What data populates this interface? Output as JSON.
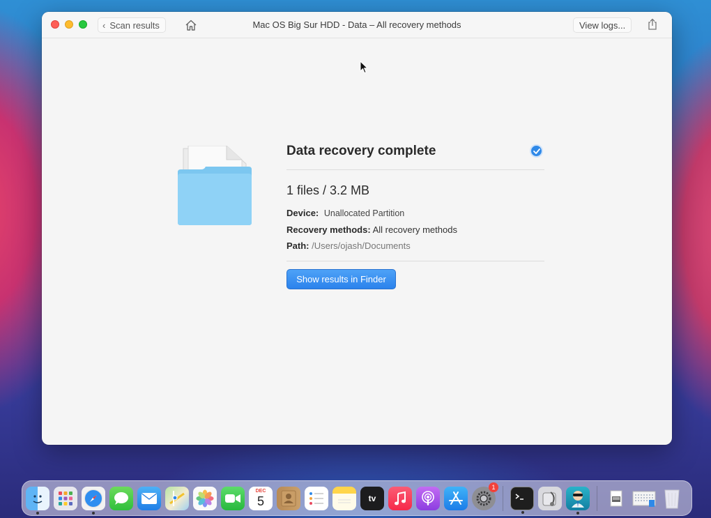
{
  "window": {
    "title": "Mac OS Big Sur HDD - Data – All recovery methods",
    "back_label": "Scan results",
    "logs_label": "View logs..."
  },
  "result": {
    "title": "Data recovery complete",
    "summary": "1 files / 3.2 MB",
    "device_key": "Device:",
    "device_value": "Unallocated Partition",
    "methods_key": "Recovery methods:",
    "methods_value": "All recovery methods",
    "path_key": "Path:",
    "path_value": "/Users/ojash/Documents",
    "button_label": "Show results in Finder"
  },
  "dock": {
    "calendar_month": "DEC",
    "calendar_day": "5",
    "appletv_label": "tv",
    "settings_badge": "1",
    "items": [
      "finder-icon",
      "launchpad-icon",
      "safari-icon",
      "messages-icon",
      "mail-icon",
      "maps-icon",
      "photos-icon",
      "facetime-icon",
      "calendar-icon",
      "contacts-icon",
      "reminders-icon",
      "notes-icon",
      "apple-tv-icon",
      "music-icon",
      "podcasts-icon",
      "app-store-icon",
      "system-preferences-icon",
      "terminal-icon",
      "disk-utility-icon",
      "disk-drill-icon",
      "downloads-stack-icon",
      "screenshots-stack-icon",
      "trash-icon"
    ]
  },
  "colors": {
    "accent": "#2b82ec",
    "check": "#2f89e8",
    "close": "#fe5f57",
    "minimize": "#febc2e",
    "maximize": "#28c840"
  }
}
